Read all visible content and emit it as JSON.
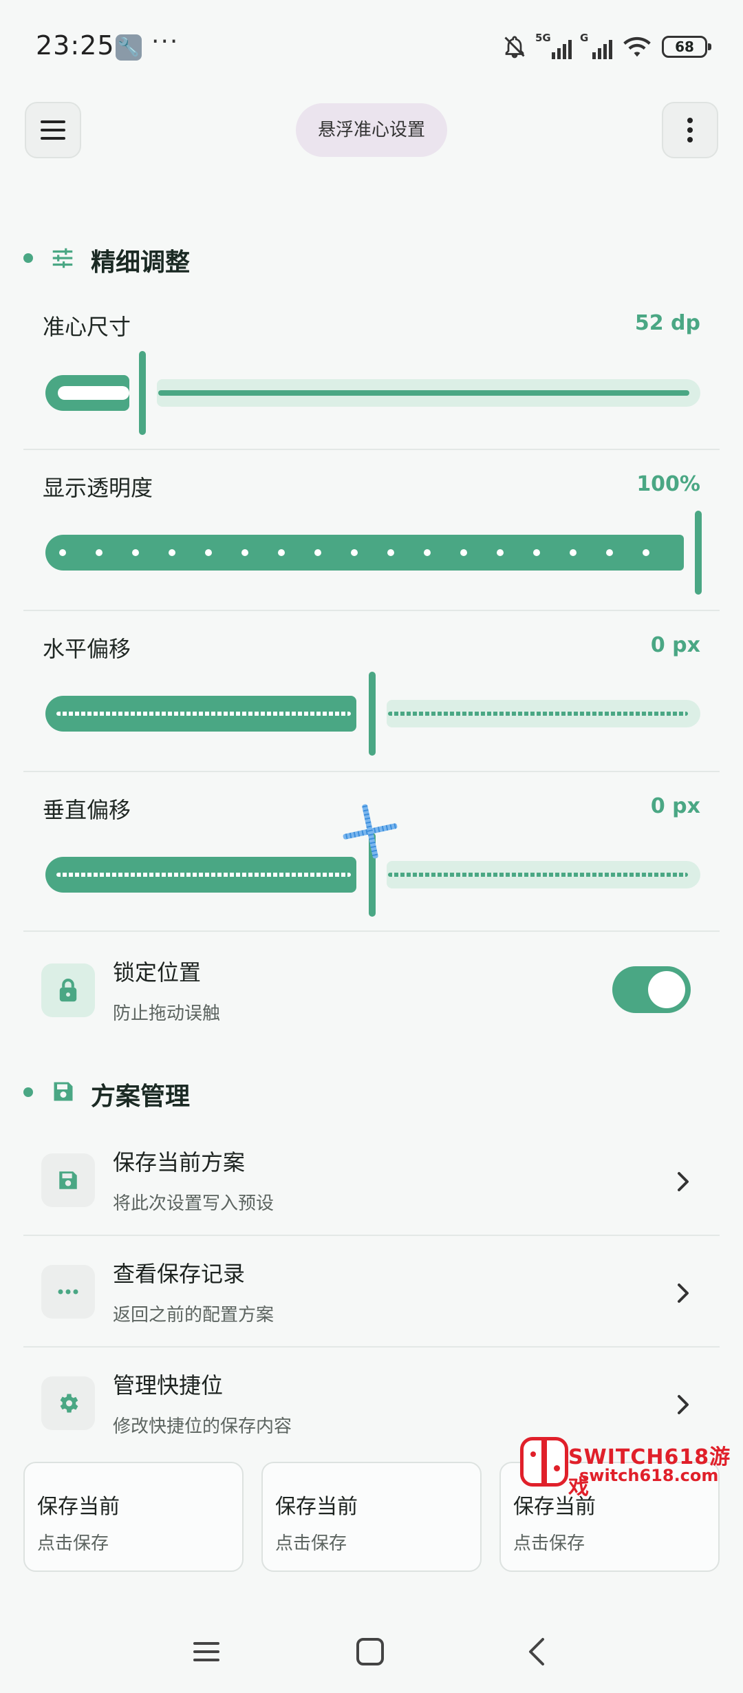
{
  "status_bar": {
    "time": "23:25",
    "dots": "···",
    "sig1_label": "5G",
    "sig2_label": "G",
    "battery": "68"
  },
  "header": {
    "title": "悬浮准心设置",
    "menu_icon": "menu-icon",
    "more_icon": "more-vert-icon"
  },
  "fine_tune": {
    "title": "精细调整",
    "icon": "tune-icon",
    "sliders": [
      {
        "label": "准心尺寸",
        "value": "52 dp",
        "level": 0.15
      },
      {
        "label": "显示透明度",
        "value": "100%",
        "level": 1.0
      },
      {
        "label": "水平偏移",
        "value": "0 px",
        "level": 0.5
      },
      {
        "label": "垂直偏移",
        "value": "0 px",
        "level": 0.5
      }
    ],
    "lock": {
      "title": "锁定位置",
      "subtitle": "防止拖动误触",
      "enabled": true,
      "icon": "lock-icon"
    }
  },
  "plans": {
    "title": "方案管理",
    "icon": "save-icon",
    "items": [
      {
        "title": "保存当前方案",
        "subtitle": "将此次设置写入预设",
        "icon": "save-icon"
      },
      {
        "title": "查看保存记录",
        "subtitle": "返回之前的配置方案",
        "icon": "more-horiz-icon"
      },
      {
        "title": "管理快捷位",
        "subtitle": "修改快捷位的保存内容",
        "icon": "gear-icon"
      }
    ],
    "slots": [
      {
        "title": "保存当前",
        "subtitle": "点击保存"
      },
      {
        "title": "保存当前",
        "subtitle": "点击保存"
      },
      {
        "title": "保存当前",
        "subtitle": "点击保存"
      }
    ]
  },
  "watermark": {
    "text": "SWITCH618游戏",
    "sub": "switch618.com"
  },
  "colors": {
    "accent": "#4aa784",
    "accent_light": "#dcefe6",
    "pill": "#ebe4ee"
  }
}
